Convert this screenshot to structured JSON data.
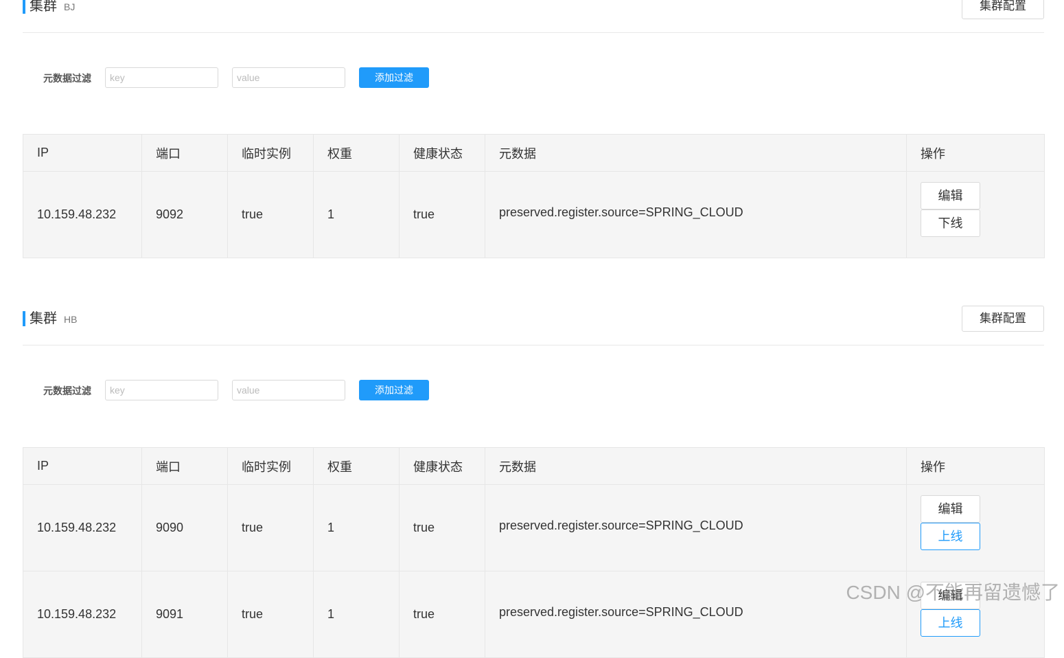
{
  "clusters": [
    {
      "title": "集群",
      "name": "BJ",
      "config_label": "集群配置",
      "filter": {
        "label": "元数据过滤",
        "key_placeholder": "key",
        "value_placeholder": "value",
        "add_label": "添加过滤"
      },
      "columns": [
        "IP",
        "端口",
        "临时实例",
        "权重",
        "健康状态",
        "元数据",
        "操作"
      ],
      "rows": [
        {
          "ip": "10.159.48.232",
          "port": "9092",
          "ephemeral": "true",
          "weight": "1",
          "healthy": "true",
          "metadata": "preserved.register.source=SPRING_CLOUD",
          "edit_label": "编辑",
          "toggle_label": "下线"
        }
      ]
    },
    {
      "title": "集群",
      "name": "HB",
      "config_label": "集群配置",
      "filter": {
        "label": "元数据过滤",
        "key_placeholder": "key",
        "value_placeholder": "value",
        "add_label": "添加过滤"
      },
      "columns": [
        "IP",
        "端口",
        "临时实例",
        "权重",
        "健康状态",
        "元数据",
        "操作"
      ],
      "rows": [
        {
          "ip": "10.159.48.232",
          "port": "9090",
          "ephemeral": "true",
          "weight": "1",
          "healthy": "true",
          "metadata": "preserved.register.source=SPRING_CLOUD",
          "edit_label": "编辑",
          "toggle_label": "上线"
        },
        {
          "ip": "10.159.48.232",
          "port": "9091",
          "ephemeral": "true",
          "weight": "1",
          "healthy": "true",
          "metadata": "preserved.register.source=SPRING_CLOUD",
          "edit_label": "编辑",
          "toggle_label": "上线"
        }
      ]
    }
  ],
  "watermark": "CSDN @不能再留遗憾了",
  "colors": {
    "accent": "#209bfa",
    "table_bg": "#f5f5f5",
    "border": "#e6e6e6"
  }
}
